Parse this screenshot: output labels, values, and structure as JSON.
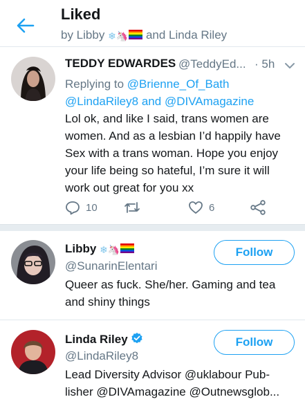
{
  "header": {
    "title": "Liked",
    "subtitle_prefix": "by Libby",
    "subtitle_suffix": "and Linda Riley"
  },
  "tweet": {
    "name": "TEDDY EDWARDES",
    "handle": "@TeddyEd...",
    "time": "· 5h",
    "replying_label": "Replying to",
    "reply_to_1": "@Brienne_Of_Bath",
    "reply_to_2": "@LindaRiley8",
    "reply_and": "and",
    "reply_to_3": "@DIVAmagazine",
    "text": "Lol ok, and like I said, trans women are women. And as a lesbian I’d happily have Sex with a trans woman. Hope you enjoy your life being so hateful, I’m sure it will work out great for you xx",
    "reply_count": "10",
    "like_count": "6"
  },
  "users": [
    {
      "name": "Libby",
      "handle": "@SunarinElentari",
      "bio": "Queer as fuck.  She/her. Gaming and tea and shiny things",
      "follow_label": "Follow"
    },
    {
      "name": "Linda Riley",
      "handle": "@LindaRiley8",
      "bio": "Lead Diversity Advisor @uklabour  Pub-lisher @DIVAmagazine @Outnewsglob...",
      "follow_label": "Follow"
    }
  ],
  "icons": {
    "back": "arrow-left-icon",
    "caret": "chevron-down-icon",
    "reply": "reply-icon",
    "retweet": "retweet-icon",
    "like": "heart-icon",
    "share": "share-icon",
    "verified": "verified-badge-icon"
  },
  "emoji": {
    "snowflake": "❄",
    "unicorn": "🦄"
  },
  "colors": {
    "accent": "#1da1f2",
    "secondary_text": "#657786",
    "divider": "#e6ecf0"
  }
}
